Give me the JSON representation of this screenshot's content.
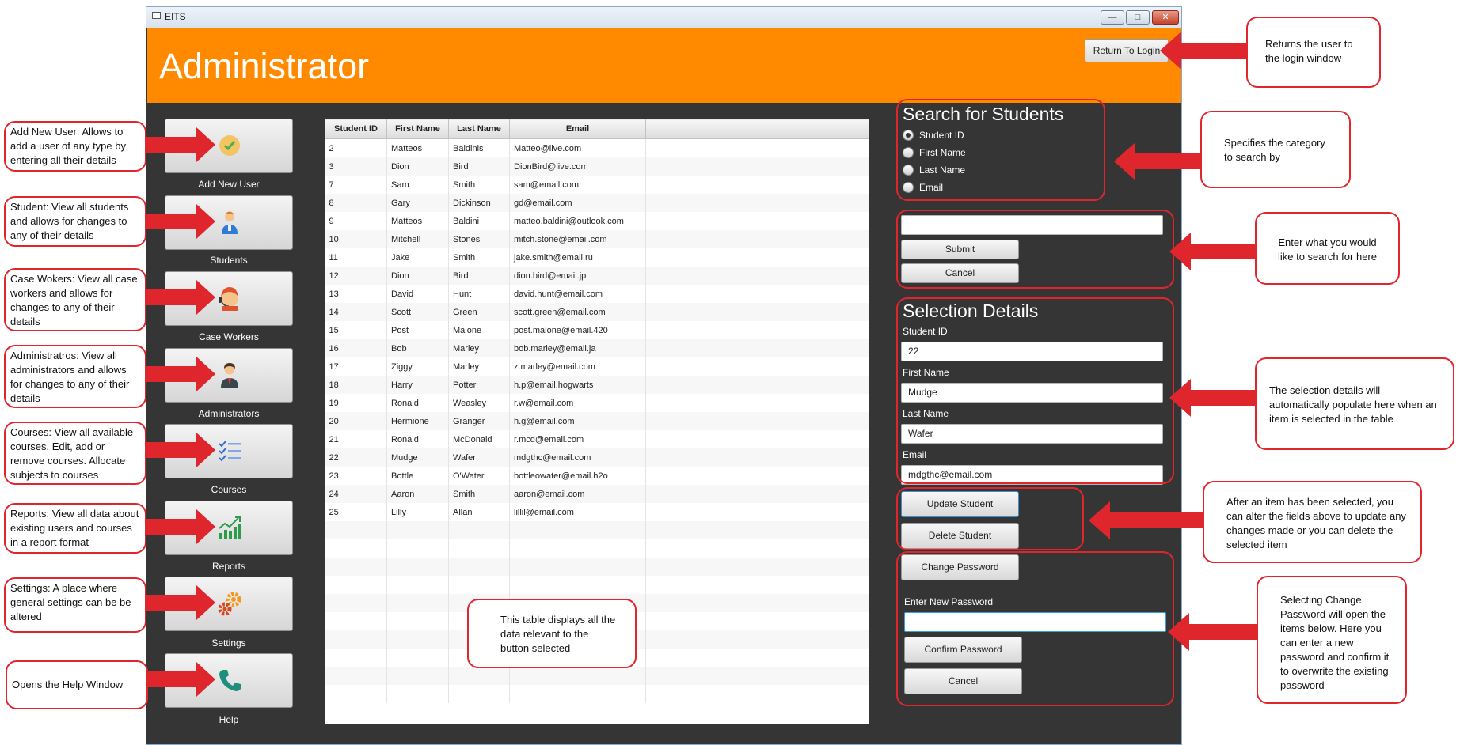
{
  "window": {
    "title": "EITS",
    "min": "—",
    "max": "□",
    "close": "✕"
  },
  "header": {
    "title": "Administrator",
    "return_label": "Return To Login"
  },
  "nav": [
    {
      "label": "Add New User",
      "icon": "check-circle-icon"
    },
    {
      "label": "Students",
      "icon": "student-person-icon"
    },
    {
      "label": "Case Workers",
      "icon": "headset-person-icon"
    },
    {
      "label": "Administrators",
      "icon": "businessman-icon"
    },
    {
      "label": "Courses",
      "icon": "checklist-icon"
    },
    {
      "label": "Reports",
      "icon": "growth-chart-icon"
    },
    {
      "label": "Settings",
      "icon": "gears-icon"
    },
    {
      "label": "Help",
      "icon": "phone-icon"
    }
  ],
  "table": {
    "columns": [
      "Student ID",
      "First Name",
      "Last Name",
      "Email"
    ],
    "rows": [
      [
        "2",
        "Matteos",
        "Baldinis",
        "Matteo@live.com"
      ],
      [
        "3",
        "Dion",
        "Bird",
        "DionBird@live.com"
      ],
      [
        "7",
        "Sam",
        "Smith",
        "sam@email.com"
      ],
      [
        "8",
        "Gary",
        "Dickinson",
        "gd@email.com"
      ],
      [
        "9",
        "Matteos",
        "Baldini",
        "matteo.baldini@outlook.com"
      ],
      [
        "10",
        "Mitchell",
        "Stones",
        "mitch.stone@email.com"
      ],
      [
        "11",
        "Jake",
        "Smith",
        "jake.smith@email.ru"
      ],
      [
        "12",
        "Dion",
        "Bird",
        "dion.bird@email.jp"
      ],
      [
        "13",
        "David",
        "Hunt",
        "david.hunt@email.com"
      ],
      [
        "14",
        "Scott",
        "Green",
        "scott.green@email.com"
      ],
      [
        "15",
        "Post",
        "Malone",
        "post.malone@email.420"
      ],
      [
        "16",
        "Bob",
        "Marley",
        "bob.marley@email.ja"
      ],
      [
        "17",
        "Ziggy",
        "Marley",
        "z.marley@email.com"
      ],
      [
        "18",
        "Harry",
        "Potter",
        "h.p@email.hogwarts"
      ],
      [
        "19",
        "Ronald",
        "Weasley",
        "r.w@email.com"
      ],
      [
        "20",
        "Hermione",
        "Granger",
        "h.g@email.com"
      ],
      [
        "21",
        "Ronald",
        "McDonald",
        "r.mcd@email.com"
      ],
      [
        "22",
        "Mudge",
        "Wafer",
        "mdgthc@email.com"
      ],
      [
        "23",
        "Bottle",
        "O'Water",
        "bottleowater@email.h2o"
      ],
      [
        "24",
        "Aaron",
        "Smith",
        "aaron@email.com"
      ],
      [
        "25",
        "Lilly",
        "Allan",
        "lillil@email.com"
      ]
    ],
    "empty_rows": 10
  },
  "search": {
    "title": "Search for Students",
    "options": [
      "Student ID",
      "First Name",
      "Last Name",
      "Email"
    ],
    "selected": 0,
    "query": "",
    "submit_label": "Submit",
    "cancel_label": "Cancel"
  },
  "details": {
    "title": "Selection Details",
    "fields": [
      {
        "label": "Student ID",
        "value": "22"
      },
      {
        "label": "First Name",
        "value": "Mudge"
      },
      {
        "label": "Last Name",
        "value": "Wafer"
      },
      {
        "label": "Email",
        "value": "mdgthc@email.com"
      }
    ],
    "update_label": "Update Student",
    "delete_label": "Delete Student"
  },
  "password": {
    "change_label": "Change Password",
    "new_label": "Enter New Password",
    "new_value": "",
    "confirm_label": "Confirm Password",
    "cancel_label": "Cancel"
  },
  "annotations": {
    "add_user": "Add New User:  Allows to add a user of any type by entering all their details",
    "students": "Student: View all students and allows for changes to any of their details",
    "case_workers": "Case Wokers: View all case workers and allows for changes to any of their details",
    "administrators": "Administratros: View all administrators and allows for changes to any of their details",
    "courses": "Courses: View all available courses. Edit, add or remove courses. Allocate subjects to courses",
    "reports": "Reports: View all data about existing users and courses in a report format",
    "settings": "Settings: A place where general settings can be be altered",
    "help": "Opens the Help Window",
    "return": "Returns the user to the login window",
    "category": "Specifies the category to search by",
    "search_input": "Enter what you would like to search for here",
    "selection": "The selection details will automatically populate here when an item is selected in the table",
    "update": "After an item has been selected, you can alter the fields above to update any changes made or you can delete the selected item",
    "password": "Selecting Change Password will open the items below. Here you can enter a new password and confirm it to overwrite the existing password",
    "table": "This table displays all the data relevant to the button selected"
  },
  "colors": {
    "header": "#ff8a00",
    "background": "#353535",
    "annotation": "#e0262d"
  }
}
